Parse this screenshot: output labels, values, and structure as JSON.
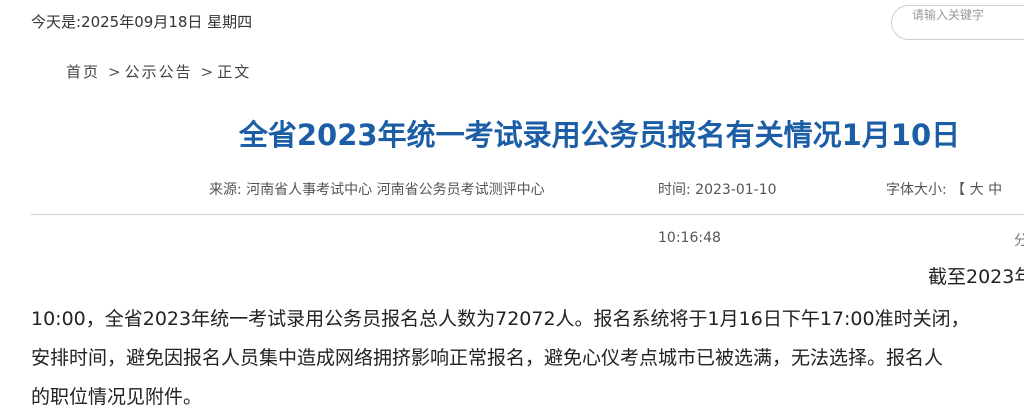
{
  "header": {
    "date_text": "今天是:2025年09月18日 星期四",
    "search_placeholder": "请输入关键字"
  },
  "breadcrumb": {
    "items": [
      "首页",
      "公示公告",
      "正文"
    ],
    "separator": ">"
  },
  "article": {
    "title": "全省2023年统一考试录用公务员报名有关情况1月10日",
    "source_label": "来源:",
    "source_value": "河南省人事考试中心 河南省公务员考试测评中心",
    "time_label": "时间:",
    "date": "2023-01-10",
    "time": "10:16:48",
    "font_size_label": "字体大小:",
    "font_size_options": [
      "【",
      "大",
      "中"
    ],
    "share_fragment": "分",
    "body_lines": [
      "截至2023年",
      "10:00，全省2023年统一考试录用公务员报名总人数为72072人。报名系统将于1月16日下午17:00准时关闭，",
      "安排时间，避免因报名人员集中造成网络拥挤影响正常报名，避免心仪考点城市已被选满，无法选择。报名人",
      "的职位情况见附件。"
    ]
  },
  "colors": {
    "title": "#1c5ea6",
    "body_text": "#222222",
    "meta_text": "#555555",
    "divider": "#cfcfcf"
  }
}
